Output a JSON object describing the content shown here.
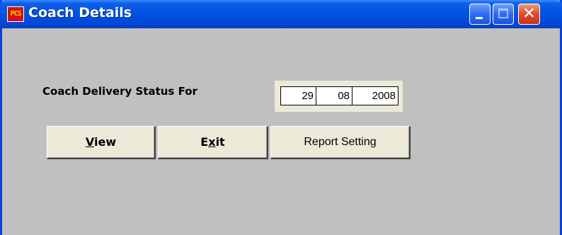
{
  "window": {
    "title": "Coach Details",
    "app_icon_text": "PCS",
    "controls": {
      "minimize": "minimize",
      "maximize": "maximize",
      "close": "✕"
    }
  },
  "form": {
    "status_label": "Coach Delivery Status For",
    "date": {
      "day": "29",
      "month": "08",
      "year": "2008"
    }
  },
  "buttons": {
    "view": {
      "mnemonic": "V",
      "rest": "iew"
    },
    "exit": {
      "lead": "E",
      "mnemonic": "x",
      "rest": "it"
    },
    "report": "Report Setting"
  },
  "colors": {
    "titlebar": "#0054e3",
    "client_bg": "#c0c0c0",
    "button_face": "#ece9d8",
    "close_button": "#e05030"
  }
}
